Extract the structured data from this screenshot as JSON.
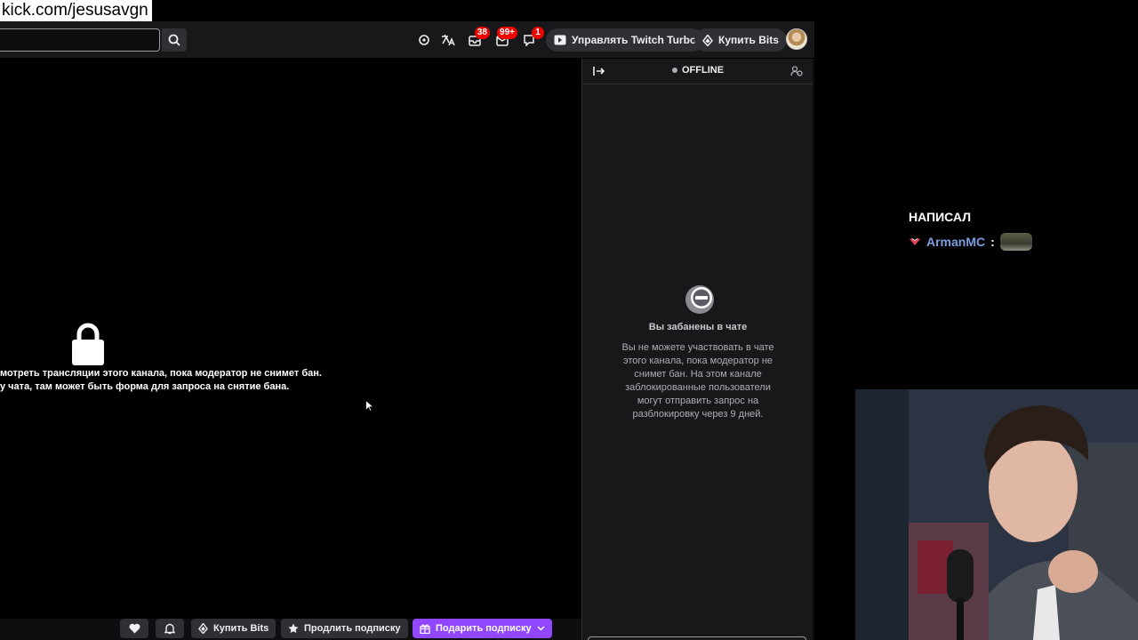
{
  "overlay": {
    "url": "kick.com/jesusavgn",
    "chat_header": "НАПИСАЛ",
    "chat_user": "ArmanMC",
    "chat_colon": ":"
  },
  "topnav": {
    "notifications": [
      {
        "icon": "loot-icon",
        "badge": ""
      },
      {
        "icon": "translate-icon",
        "badge": ""
      },
      {
        "icon": "inbox-icon",
        "badge": "38"
      },
      {
        "icon": "mail-icon",
        "badge": "99+"
      },
      {
        "icon": "whispers-icon",
        "badge": "1"
      }
    ],
    "turbo_label": "Управлять Twitch Turbo",
    "bits_label": "Купить Bits"
  },
  "player": {
    "ban_message_line1": "мотреть трансляции этого канала, пока модератор не снимет бан.",
    "ban_message_line2": "у чата, там может быть форма для запроса на снятие бана."
  },
  "bottom_bar": {
    "bits_label": "Купить Bits",
    "extend_label": "Продлить подписку",
    "gift_label": "Подарить подписку"
  },
  "chat": {
    "status": "OFFLINE",
    "banned_title": "Вы забанены в чате",
    "banned_description": "Вы не можете участвовать в чате этого канала, пока модератор не снимет бан. На этом канале заблокированные пользователи могут отправить запрос на разблокировку через 9 дней."
  },
  "colors": {
    "accent": "#9147ff",
    "badge": "#eb0400",
    "username": "#7a9fe0"
  }
}
